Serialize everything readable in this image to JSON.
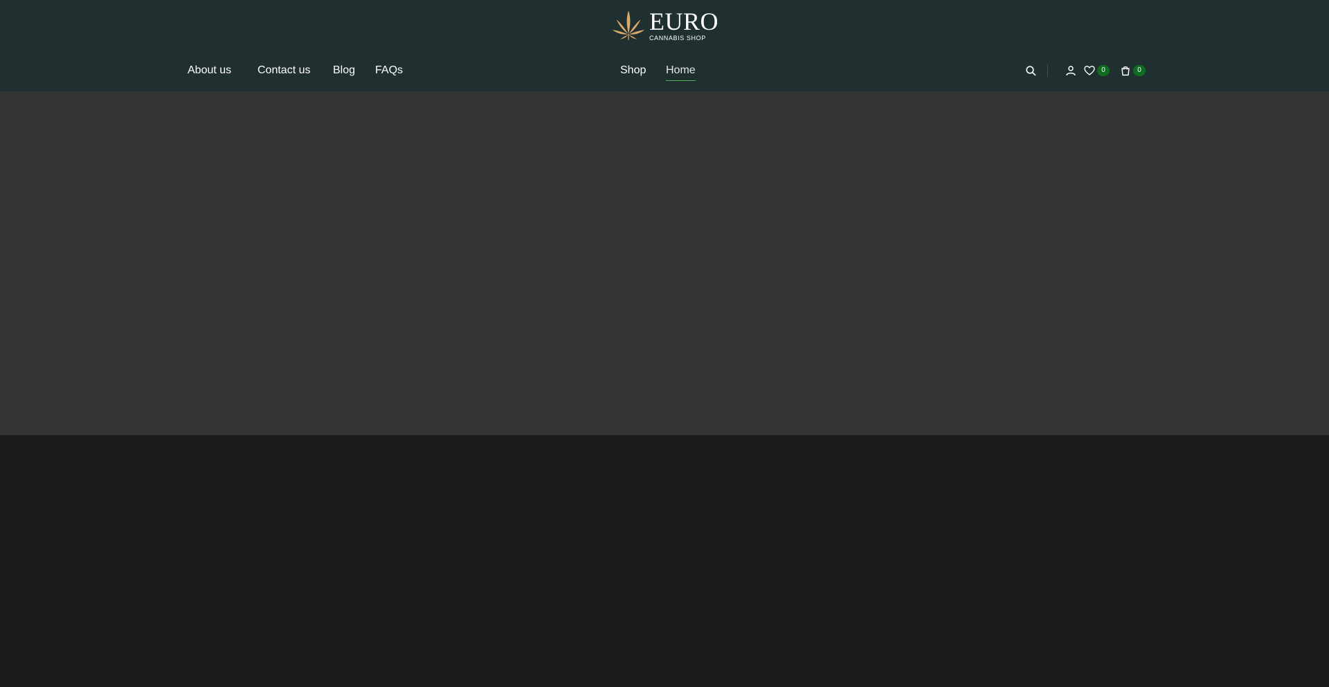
{
  "brand": {
    "name": "EURO",
    "tagline": "CANNABIS SHOP",
    "logo_icon": "cannabis-leaf-icon",
    "logo_color": "#d9a86b"
  },
  "nav": {
    "left": [
      "About us",
      "Contact us",
      "Blog",
      "FAQs"
    ],
    "center": [
      "Shop",
      "Home"
    ],
    "active": "Home"
  },
  "header_icons": {
    "search": "search-icon",
    "account": "user-icon",
    "wishlist": "heart-icon",
    "cart": "cart-icon"
  },
  "counts": {
    "wishlist": "0",
    "cart": "0"
  },
  "colors": {
    "header_bg": "#203030",
    "hero_bg": "#333333",
    "page_bg": "#1b1b1b",
    "badge_bg": "#0f6b1f",
    "active_underline": "#4caf50"
  }
}
